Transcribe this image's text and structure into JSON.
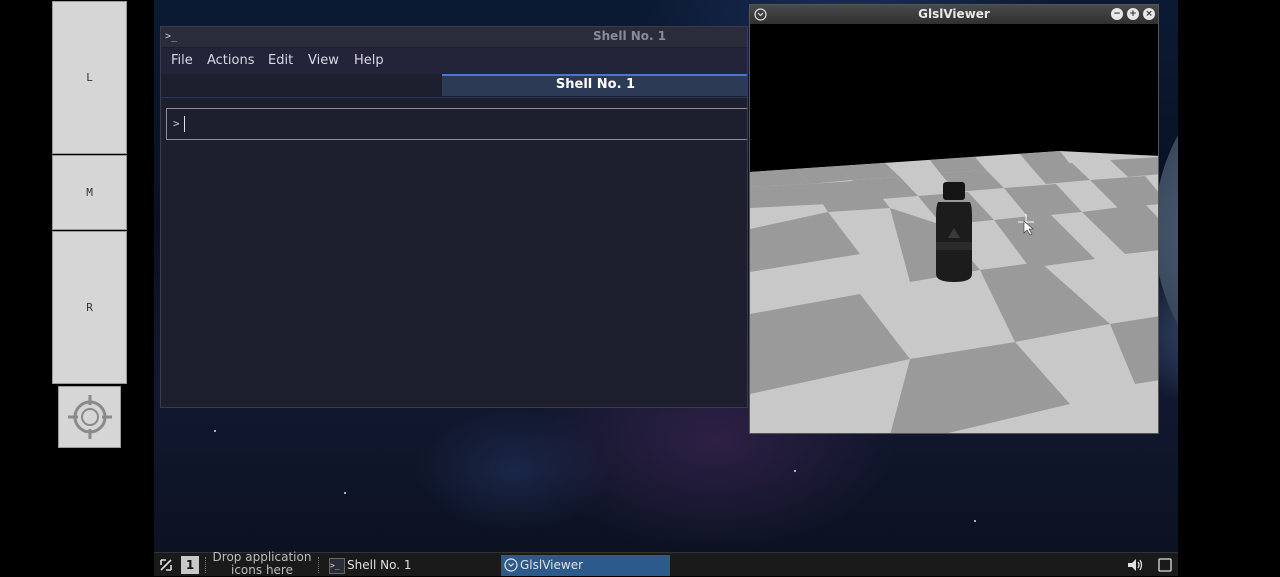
{
  "mouse_panel": {
    "left_label": "L",
    "middle_label": "M",
    "right_label": "R",
    "target_icon": "crosshair-icon"
  },
  "shell_window": {
    "title": "Shell No. 1",
    "menu": [
      "File",
      "Actions",
      "Edit",
      "View",
      "Help"
    ],
    "active_tab": "Shell No. 1",
    "prompt_symbol": ">"
  },
  "glsl_window": {
    "title": "GlslViewer",
    "buttons": [
      "minimize-icon",
      "maximize-icon",
      "close-icon"
    ]
  },
  "taskbar": {
    "desktop_number": "1",
    "drop_hint_line1": "Drop application",
    "drop_hint_line2": "icons here",
    "tasks": [
      {
        "label": "Shell No. 1",
        "icon": "terminal-icon",
        "active": false
      },
      {
        "label": "GlslViewer",
        "icon": "glsl-icon",
        "active": true
      }
    ],
    "tray": [
      "volume-icon",
      "show-desktop-icon"
    ]
  },
  "colors": {
    "shell_bg": "#1d1e2e",
    "tab_accent": "#4a78c8",
    "task_active": "#2c5a8a"
  }
}
